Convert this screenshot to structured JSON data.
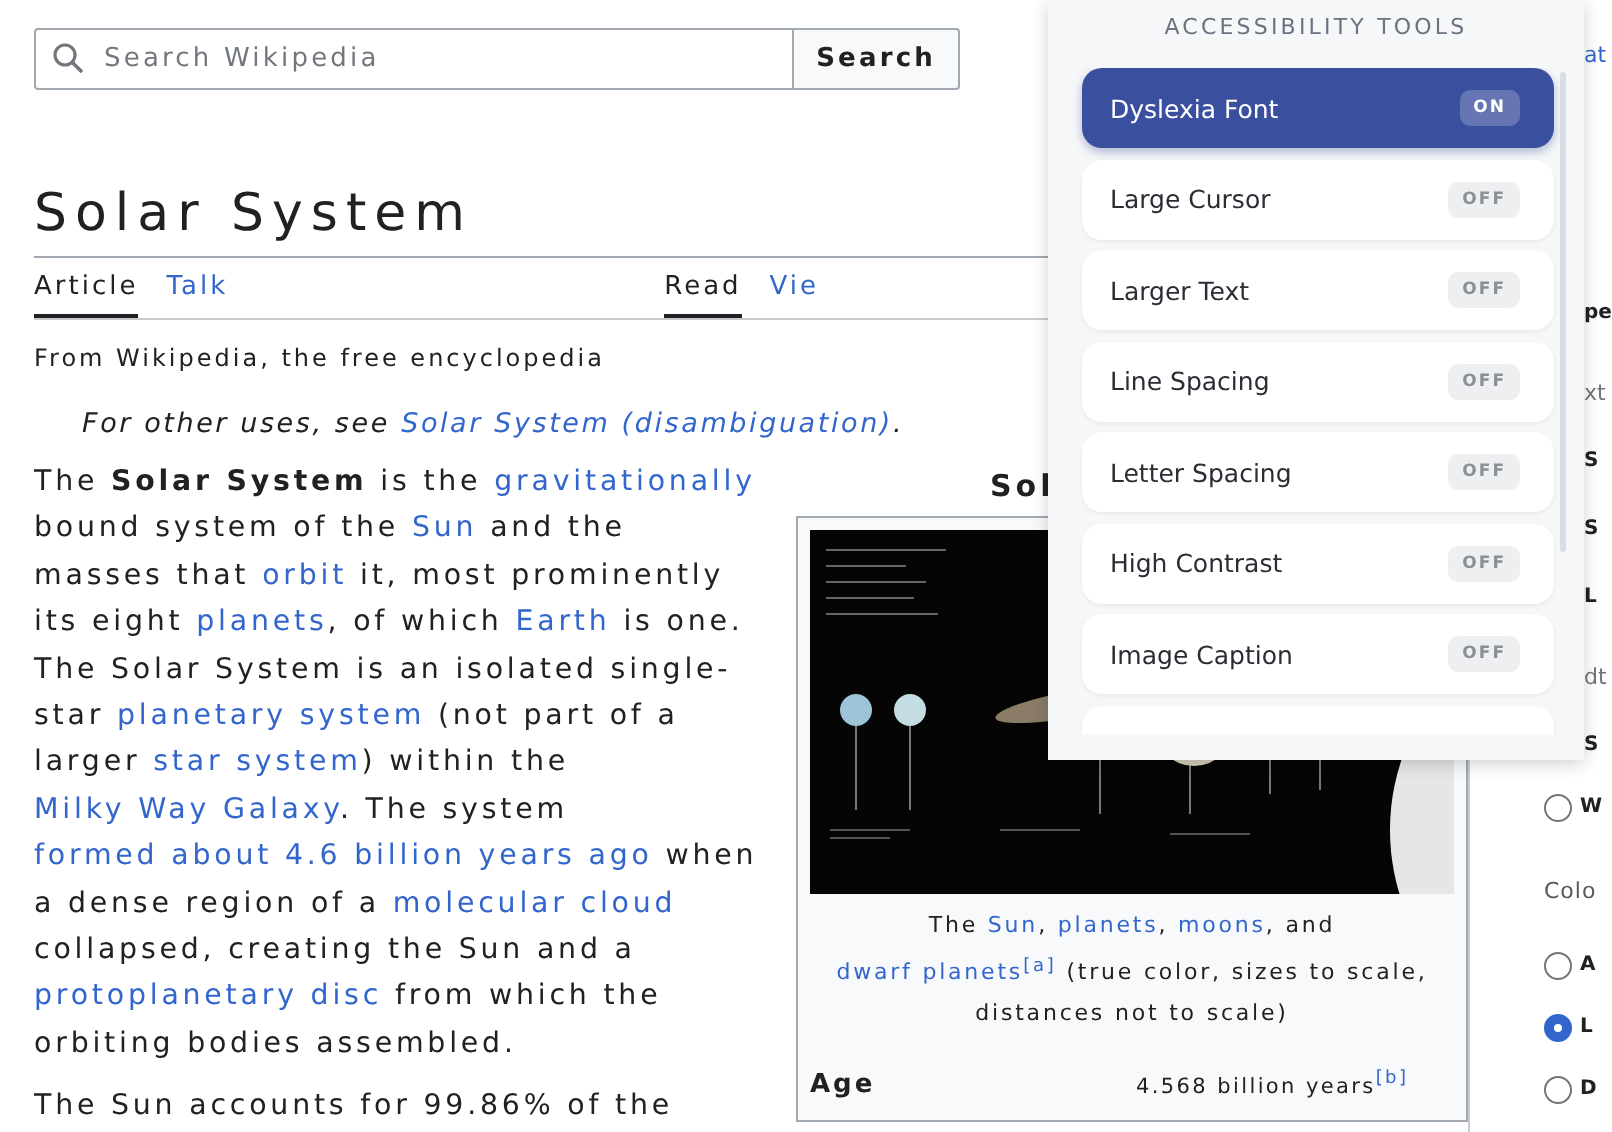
{
  "search": {
    "placeholder": "Search Wikipedia",
    "button": "Search"
  },
  "title": "Solar System",
  "tabs_left": [
    {
      "label": "Article",
      "selected": true
    },
    {
      "label": "Talk",
      "selected": false
    }
  ],
  "tabs_right": [
    {
      "label": "Read",
      "selected": true
    },
    {
      "label": "Vie",
      "selected": false
    }
  ],
  "tagline": "From Wikipedia, the free encyclopedia",
  "hatnote": {
    "text": "For other uses, see ",
    "link": "Solar System (disambiguation)",
    "end": "."
  },
  "paragraph": [
    {
      "kind": "plain",
      "text": "The "
    },
    {
      "kind": "bold",
      "text": "Solar System"
    },
    {
      "kind": "plain",
      "text": " is the "
    },
    {
      "kind": "link",
      "text": "gravitationally"
    },
    {
      "kind": "plain",
      "text": " bound system of the "
    },
    {
      "kind": "link",
      "text": "Sun"
    },
    {
      "kind": "plain",
      "text": " and the masses that "
    },
    {
      "kind": "link",
      "text": "orbit"
    },
    {
      "kind": "plain",
      "text": " it, most prominently its eight "
    },
    {
      "kind": "link",
      "text": "planets"
    },
    {
      "kind": "plain",
      "text": ", of which "
    },
    {
      "kind": "link",
      "text": "Earth"
    },
    {
      "kind": "plain",
      "text": " is one. The Solar System is an isolated single-star "
    },
    {
      "kind": "link",
      "text": "planetary system"
    },
    {
      "kind": "plain",
      "text": " (not part of a larger "
    },
    {
      "kind": "link",
      "text": "star system"
    },
    {
      "kind": "plain",
      "text": ") within the "
    },
    {
      "kind": "link",
      "text": "Milky Way Galaxy"
    },
    {
      "kind": "plain",
      "text": ". The system "
    },
    {
      "kind": "link",
      "text": "formed about 4.6 billion years ago"
    },
    {
      "kind": "plain",
      "text": " when a dense region of a "
    },
    {
      "kind": "link",
      "text": "molecular cloud"
    },
    {
      "kind": "plain",
      "text": " collapsed, creating the Sun and a "
    },
    {
      "kind": "link",
      "text": "protoplanetary disc"
    },
    {
      "kind": "plain",
      "text": " from which the orbiting bodies assembled."
    }
  ],
  "paragraph_2": "The Sun accounts for 99.86% of the",
  "infobox": {
    "title": "Sol",
    "caption": [
      {
        "kind": "plain",
        "text": "The "
      },
      {
        "kind": "link",
        "text": "Sun"
      },
      {
        "kind": "plain",
        "text": ", "
      },
      {
        "kind": "link",
        "text": "planets"
      },
      {
        "kind": "plain",
        "text": ", "
      },
      {
        "kind": "link",
        "text": "moons"
      },
      {
        "kind": "plain",
        "text": ", and "
      },
      {
        "kind": "link",
        "text": "dwarf planets"
      },
      {
        "kind": "note",
        "text": "$^{[a]}$"
      },
      {
        "kind": "plain",
        "text": " (true color, sizes to scale, distances not to scale)"
      }
    ],
    "rows": [
      {
        "label": "Age",
        "value": "4.568 billion years",
        "note": "$^{[b]}$"
      }
    ]
  },
  "sidebar": [
    {
      "kind": "link",
      "text": "at"
    },
    {
      "kind": "label",
      "text": "pe"
    },
    {
      "kind": "muted",
      "text": "xt"
    },
    {
      "kind": "label",
      "text": "S"
    },
    {
      "kind": "label",
      "text": "S"
    },
    {
      "kind": "label",
      "text": "L"
    },
    {
      "kind": "muted",
      "text": "dt"
    },
    {
      "kind": "label",
      "text": "S"
    },
    {
      "kind": "radio",
      "text": "W",
      "selected": false
    },
    {
      "kind": "heading",
      "text": "Colo"
    },
    {
      "kind": "radio",
      "text": "A",
      "selected": false
    },
    {
      "kind": "radio",
      "text": "L",
      "selected": true
    },
    {
      "kind": "radio",
      "text": "D",
      "selected": false
    }
  ],
  "panel": {
    "title": "ACCESSIBILITY TOOLS",
    "tools": [
      {
        "label": "Dyslexia Font",
        "state": "ON",
        "on": true
      },
      {
        "label": "Large Cursor",
        "state": "OFF",
        "on": false
      },
      {
        "label": "Larger Text",
        "state": "OFF",
        "on": false
      },
      {
        "label": "Line Spacing",
        "state": "OFF",
        "on": false
      },
      {
        "label": "Letter Spacing",
        "state": "OFF",
        "on": false
      },
      {
        "label": "High Contrast",
        "state": "OFF",
        "on": false
      },
      {
        "label": "Image Caption",
        "state": "OFF",
        "on": false
      }
    ]
  }
}
